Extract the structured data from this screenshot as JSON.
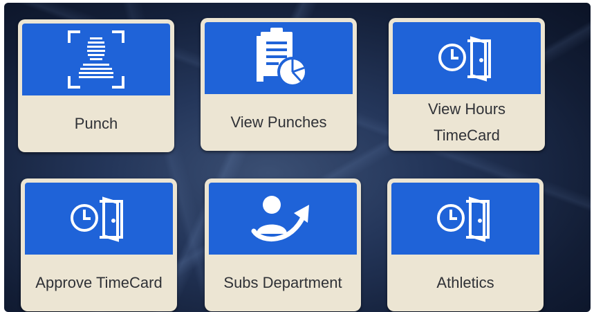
{
  "tiles": [
    {
      "label": "Punch",
      "icon": "face-scan-icon"
    },
    {
      "label": "View Punches",
      "icon": "clipboard-chart-icon"
    },
    {
      "label": "View Hours\nTimeCard",
      "icon": "clock-door-icon"
    },
    {
      "label": "Approve TimeCard",
      "icon": "clock-door-icon"
    },
    {
      "label": "Subs Department",
      "icon": "person-arrow-icon"
    },
    {
      "label": "Athletics",
      "icon": "clock-door-icon"
    }
  ],
  "colors": {
    "tile_header": "#1f63d8",
    "tile_body": "#ece5d3",
    "label_text": "#2f3136",
    "background": "#1c2b4a"
  }
}
